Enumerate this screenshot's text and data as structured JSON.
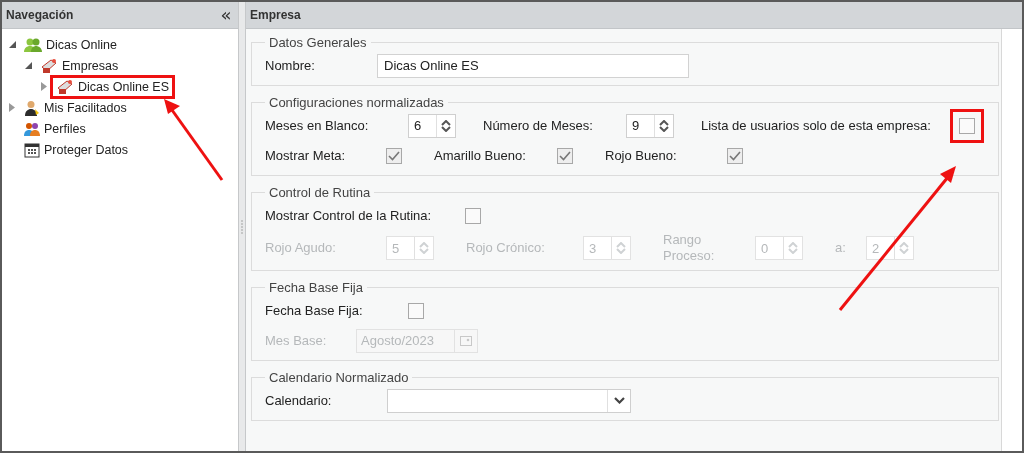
{
  "navigation": {
    "title": "Navegación",
    "collapse_glyph": "«",
    "tree": [
      {
        "label": "Dicas Online",
        "kind": "group",
        "expanded": true,
        "highlighted": false,
        "children": [
          {
            "label": "Empresas",
            "kind": "company",
            "expanded": true,
            "highlighted": false,
            "children": [
              {
                "label": "Dicas Online ES",
                "kind": "company",
                "expanded": false,
                "highlighted": true
              }
            ]
          }
        ]
      },
      {
        "label": "Mis Facilitados",
        "kind": "user",
        "expanded": false,
        "highlighted": false
      },
      {
        "label": "Perfiles",
        "kind": "profiles",
        "highlighted": false
      },
      {
        "label": "Proteger Datos",
        "kind": "calendar",
        "highlighted": false
      }
    ]
  },
  "panel": {
    "title": "Empresa",
    "sections": [
      {
        "legend": "Datos Generales",
        "rows": [
          [
            {
              "label": "Nombre:",
              "kind": "text",
              "value": "Dicas Online ES",
              "disabled": false
            }
          ]
        ]
      },
      {
        "legend": "Configuraciones normalizadas",
        "rows": [
          [
            {
              "label": "Meses en Blanco:",
              "kind": "spinner",
              "value": "6",
              "disabled": false
            },
            {
              "label": "Número de Meses:",
              "kind": "spinner",
              "value": "9",
              "disabled": false
            },
            {
              "label": "Lista de usuarios solo de esta empresa:",
              "kind": "checkbox",
              "checked": false,
              "disabled": false,
              "highlighted": true
            }
          ],
          [
            {
              "label": "Mostrar Meta:",
              "kind": "checkbox",
              "checked": true,
              "disabled": false,
              "highlighted": false
            },
            {
              "label": "Amarillo Bueno:",
              "kind": "checkbox",
              "checked": true,
              "disabled": false,
              "highlighted": false
            },
            {
              "label": "Rojo Bueno:",
              "kind": "checkbox",
              "checked": true,
              "disabled": false,
              "highlighted": false
            }
          ]
        ]
      },
      {
        "legend": "Control de Rutina",
        "rows": [
          [
            {
              "label": "Mostrar Control de la Rutina:",
              "kind": "checkbox",
              "checked": false,
              "disabled": false,
              "highlighted": false
            }
          ],
          [
            {
              "label": "Rojo Agudo:",
              "kind": "spinner",
              "value": "5",
              "disabled": true
            },
            {
              "label": "Rojo Crónico:",
              "kind": "spinner",
              "value": "3",
              "disabled": true
            },
            {
              "label": "Rango Proceso:",
              "kind": "spinner",
              "value": "0",
              "disabled": true
            },
            {
              "label": "a:",
              "kind": "spinner",
              "value": "2",
              "disabled": true
            }
          ]
        ]
      },
      {
        "legend": "Fecha Base Fija",
        "rows": [
          [
            {
              "label": "Fecha Base Fija:",
              "kind": "checkbox",
              "checked": false,
              "disabled": false,
              "highlighted": false
            }
          ],
          [
            {
              "label": "Mes Base:",
              "kind": "date",
              "value": "Agosto/2023",
              "disabled": true
            }
          ]
        ]
      },
      {
        "legend": "Calendario Normalizado",
        "rows": [
          [
            {
              "label": "Calendario:",
              "kind": "select",
              "disabled": false
            }
          ]
        ]
      }
    ]
  }
}
